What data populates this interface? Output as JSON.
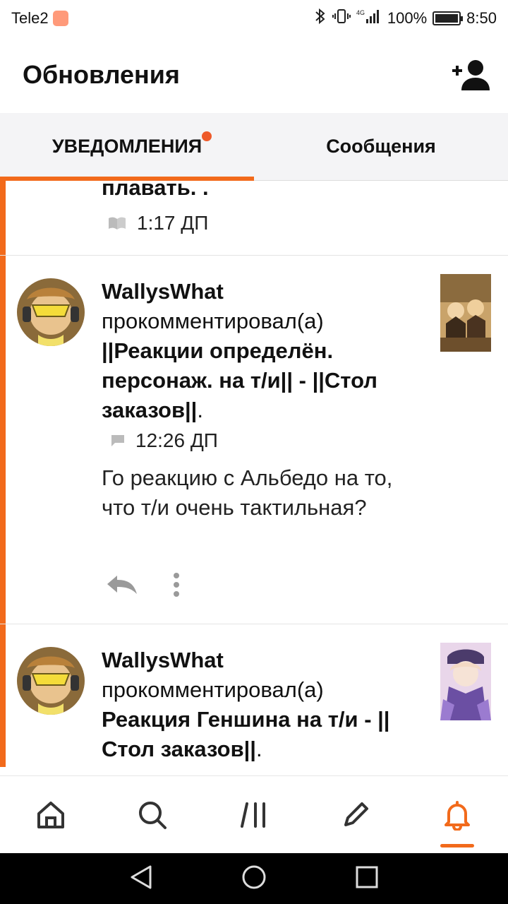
{
  "status_bar": {
    "carrier": "Tele2",
    "battery": "100%",
    "time": "8:50",
    "network": "4G"
  },
  "app_bar": {
    "title": "Обновления",
    "add_friend_icon": "add-user-icon"
  },
  "tabs": [
    {
      "label": "УВЕДОМЛЕНИЯ",
      "active": true,
      "has_dot": true
    },
    {
      "label": "Сообщения",
      "active": false
    }
  ],
  "feed": {
    "partial_item": {
      "text_tail": "плавать. .",
      "time": "1:17 ДП",
      "icon": "book-icon"
    },
    "items": [
      {
        "username": "WallysWhat",
        "action": "прокомментировал(а)",
        "post_title": "||Реакции определён. персонаж. на т/и|| - ||Стол заказов||",
        "time": "12:26 ДП",
        "icon": "comment-icon",
        "comment": "Го реакцию с Альбедо на то, что т/и очень тактильная?"
      },
      {
        "username": "WallysWhat",
        "action": "прокомментировал(а)",
        "post_title": "Реакция Геншина на т/и - ||Стол заказов||"
      }
    ]
  },
  "bottom_nav": [
    {
      "icon": "home-icon"
    },
    {
      "icon": "search-icon"
    },
    {
      "icon": "library-icon"
    },
    {
      "icon": "pencil-icon"
    },
    {
      "icon": "bell-icon",
      "active": true
    }
  ],
  "colors": {
    "accent": "#f26a1b",
    "dot": "#ee5a2a"
  }
}
